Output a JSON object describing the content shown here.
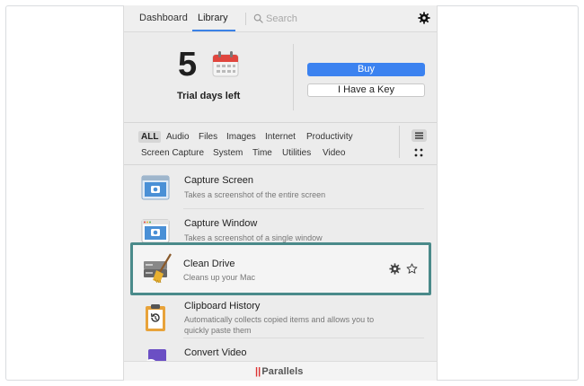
{
  "header": {
    "tabs": [
      {
        "label": "Dashboard",
        "active": false
      },
      {
        "label": "Library",
        "active": true
      }
    ],
    "search_placeholder": "Search"
  },
  "trial": {
    "days": "5",
    "label": "Trial days left",
    "buy_label": "Buy",
    "key_label": "I Have a Key"
  },
  "filters": {
    "row1": [
      "ALL",
      "Audio",
      "Files",
      "Images",
      "Internet",
      "Productivity"
    ],
    "row2": [
      "Screen Capture",
      "System",
      "Time",
      "Utilities",
      "Video"
    ],
    "selected": "ALL"
  },
  "apps": [
    {
      "name": "Capture Screen",
      "desc": "Takes a screenshot of the entire screen",
      "icon": "capture-screen-icon"
    },
    {
      "name": "Capture Window",
      "desc": "Takes a screenshot of a single window",
      "icon": "capture-window-icon"
    },
    {
      "name": "Clean Drive",
      "desc": "Cleans up your Mac",
      "icon": "clean-drive-icon",
      "highlighted": true
    },
    {
      "name": "Clipboard History",
      "desc": "Automatically collects copied items and allows you to quickly paste them",
      "icon": "clipboard-icon"
    },
    {
      "name": "Convert Video",
      "desc": "",
      "icon": "convert-video-icon"
    }
  ],
  "footer": {
    "brand": "Parallels"
  },
  "colors": {
    "accent": "#3b82f0",
    "highlight_border": "#4a8a8a"
  }
}
